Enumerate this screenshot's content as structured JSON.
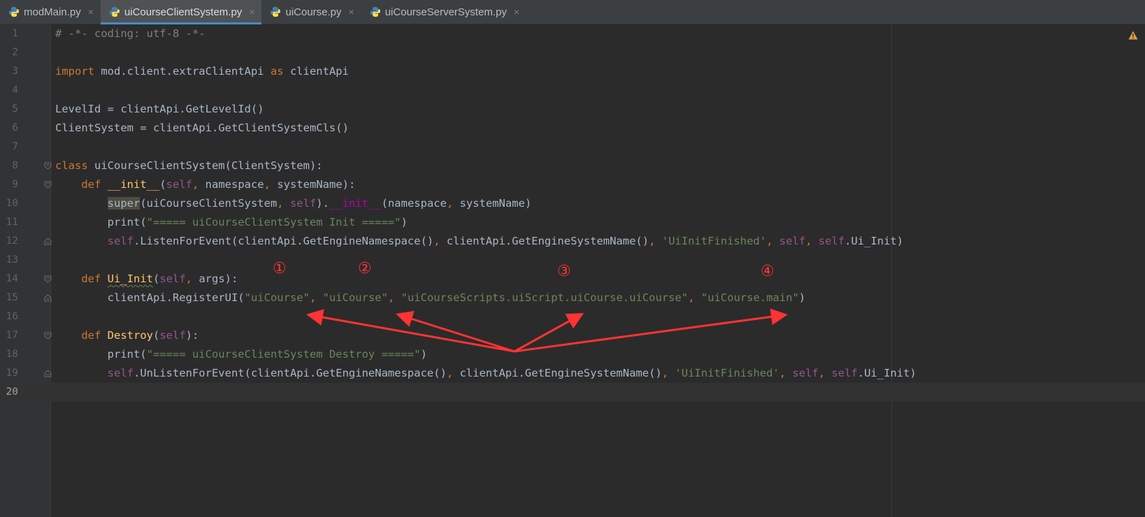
{
  "tabs": [
    {
      "label": "modMain.py",
      "icon": "python-file-icon",
      "active": false
    },
    {
      "label": "uiCourseClientSystem.py",
      "icon": "python-file-icon",
      "active": true
    },
    {
      "label": "uiCourse.py",
      "icon": "python-file-icon",
      "active": false
    },
    {
      "label": "uiCourseServerSystem.py",
      "icon": "python-file-icon",
      "active": false
    }
  ],
  "close_glyph": "×",
  "editor": {
    "current_line": 20,
    "lines": [
      {
        "n": "1",
        "tokens": [
          [
            "cmt",
            "# -*- coding: utf-8 -*-"
          ]
        ]
      },
      {
        "n": "2",
        "tokens": []
      },
      {
        "n": "3",
        "tokens": [
          [
            "kw",
            "import "
          ],
          [
            "",
            "mod.client.extraClientApi "
          ],
          [
            "kw",
            "as "
          ],
          [
            "",
            "clientApi"
          ]
        ]
      },
      {
        "n": "4",
        "tokens": []
      },
      {
        "n": "5",
        "tokens": [
          [
            "",
            "LevelId = clientApi.GetLevelId()"
          ]
        ]
      },
      {
        "n": "6",
        "tokens": [
          [
            "",
            "ClientSystem = clientApi.GetClientSystemCls()"
          ]
        ]
      },
      {
        "n": "7",
        "tokens": []
      },
      {
        "n": "8",
        "tokens": [
          [
            "kw",
            "class "
          ],
          [
            "",
            "uiCourseClientSystem(ClientSystem):"
          ]
        ]
      },
      {
        "n": "9",
        "tokens": [
          [
            "",
            "    "
          ],
          [
            "kw",
            "def "
          ],
          [
            "fn",
            "__init__"
          ],
          [
            "",
            "("
          ],
          [
            "slf",
            "self"
          ],
          [
            "kw",
            ", "
          ],
          [
            "",
            "namespace"
          ],
          [
            "kw",
            ", "
          ],
          [
            "",
            "systemName):"
          ]
        ]
      },
      {
        "n": "10",
        "tokens": [
          [
            "",
            "        "
          ],
          [
            "sup",
            "super"
          ],
          [
            "",
            "(uiCourseClientSystem"
          ],
          [
            "kw",
            ", "
          ],
          [
            "slf",
            "self"
          ],
          [
            "",
            ")."
          ],
          [
            "mag",
            "__init__"
          ],
          [
            "",
            "(namespace"
          ],
          [
            "kw",
            ", "
          ],
          [
            "",
            "systemName)"
          ]
        ]
      },
      {
        "n": "11",
        "tokens": [
          [
            "",
            "        "
          ],
          [
            "",
            "print("
          ],
          [
            "str",
            "\"===== uiCourseClientSystem Init =====\""
          ],
          [
            "",
            ")"
          ]
        ]
      },
      {
        "n": "12",
        "tokens": [
          [
            "",
            "        "
          ],
          [
            "slf",
            "self"
          ],
          [
            "",
            ".ListenForEvent(clientApi.GetEngineNamespace()"
          ],
          [
            "kw",
            ", "
          ],
          [
            "",
            "clientApi.GetEngineSystemName()"
          ],
          [
            "kw",
            ", "
          ],
          [
            "str",
            "'UiInitFinished'"
          ],
          [
            "kw",
            ", "
          ],
          [
            "slf",
            "self"
          ],
          [
            "kw",
            ", "
          ],
          [
            "slf",
            "self"
          ],
          [
            "",
            ".Ui_Init)"
          ]
        ]
      },
      {
        "n": "13",
        "tokens": []
      },
      {
        "n": "14",
        "tokens": [
          [
            "",
            "    "
          ],
          [
            "kw",
            "def "
          ],
          [
            "fnw",
            "Ui_Init"
          ],
          [
            "",
            "("
          ],
          [
            "slf",
            "self"
          ],
          [
            "kw",
            ", "
          ],
          [
            "",
            "args):"
          ]
        ]
      },
      {
        "n": "15",
        "tokens": [
          [
            "",
            "        "
          ],
          [
            "",
            "clientApi.RegisterUI("
          ],
          [
            "str",
            "\"uiCourse\""
          ],
          [
            "kw",
            ", "
          ],
          [
            "str",
            "\"uiCourse\""
          ],
          [
            "kw",
            ", "
          ],
          [
            "str",
            "\"uiCourseScripts.uiScript.uiCourse.uiCourse\""
          ],
          [
            "kw",
            ", "
          ],
          [
            "str",
            "\"uiCourse.main\""
          ],
          [
            "",
            ")"
          ]
        ]
      },
      {
        "n": "16",
        "tokens": []
      },
      {
        "n": "17",
        "tokens": [
          [
            "",
            "    "
          ],
          [
            "kw",
            "def "
          ],
          [
            "fn",
            "Destroy"
          ],
          [
            "",
            "("
          ],
          [
            "slf",
            "self"
          ],
          [
            "",
            "):"
          ]
        ]
      },
      {
        "n": "18",
        "tokens": [
          [
            "",
            "        "
          ],
          [
            "",
            "print("
          ],
          [
            "str",
            "\"===== uiCourseClientSystem Destroy =====\""
          ],
          [
            "",
            ")"
          ]
        ]
      },
      {
        "n": "19",
        "tokens": [
          [
            "",
            "        "
          ],
          [
            "slf",
            "self"
          ],
          [
            "",
            ".UnListenForEvent(clientApi.GetEngineNamespace()"
          ],
          [
            "kw",
            ", "
          ],
          [
            "",
            "clientApi.GetEngineSystemName()"
          ],
          [
            "kw",
            ", "
          ],
          [
            "str",
            "'UiInitFinished'"
          ],
          [
            "kw",
            ", "
          ],
          [
            "slf",
            "self"
          ],
          [
            "kw",
            ", "
          ],
          [
            "slf",
            "self"
          ],
          [
            "",
            ".Ui_Init)"
          ]
        ]
      },
      {
        "n": "20",
        "tokens": []
      }
    ],
    "fold_markers": {
      "8": "open",
      "9": "open",
      "12": "close",
      "14": "open",
      "15": "close",
      "17": "open",
      "19": "close"
    }
  },
  "annotations": {
    "color": "#ff3333",
    "markers": [
      "①",
      "②",
      "③",
      "④"
    ]
  },
  "colors": {
    "background": "#2b2b2b",
    "keyword": "#cc7832",
    "string": "#6a8759",
    "self": "#94558d",
    "function": "#ffc66d",
    "comment": "#808080",
    "default_text": "#a9b7c6"
  },
  "icons": {
    "warning": "warning-icon"
  }
}
